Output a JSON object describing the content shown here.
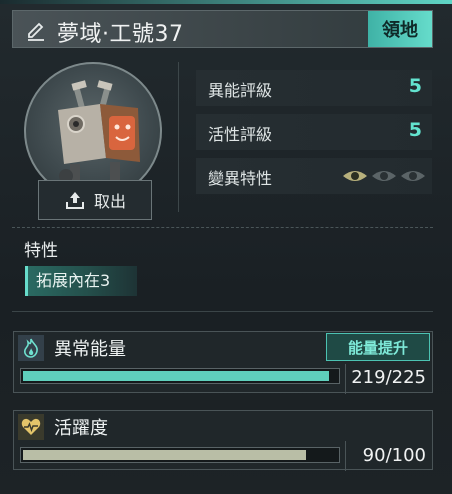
{
  "header": {
    "title": "夢域·工號37",
    "badge": "領地"
  },
  "portrait": {
    "retrieve_label": "取出"
  },
  "stats": [
    {
      "label": "異能評級",
      "value": "5"
    },
    {
      "label": "活性評級",
      "value": "5"
    },
    {
      "label": "變異特性",
      "eyes_active": 1,
      "eyes_total": 3
    }
  ],
  "traits": {
    "heading": "特性",
    "items": [
      "拓展內在3"
    ]
  },
  "energy": {
    "title": "異常能量",
    "boost_label": "能量提升",
    "value_text": "219/225",
    "current": 219,
    "max": 225,
    "fill_color": "#5fcfbc"
  },
  "vitality": {
    "title": "活躍度",
    "value_text": "90/100",
    "current": 90,
    "max": 100,
    "fill_color": "#b9bea6"
  },
  "colors": {
    "accent": "#63e3cf",
    "badge_bg": "#5ad1c0",
    "vitality_icon": "#e3c46a"
  },
  "icons": {
    "title": "pencil-icon",
    "retrieve": "upload-icon",
    "energy": "flame-icon",
    "vitality": "heartbeat-icon",
    "mutation": "eye-icon"
  }
}
